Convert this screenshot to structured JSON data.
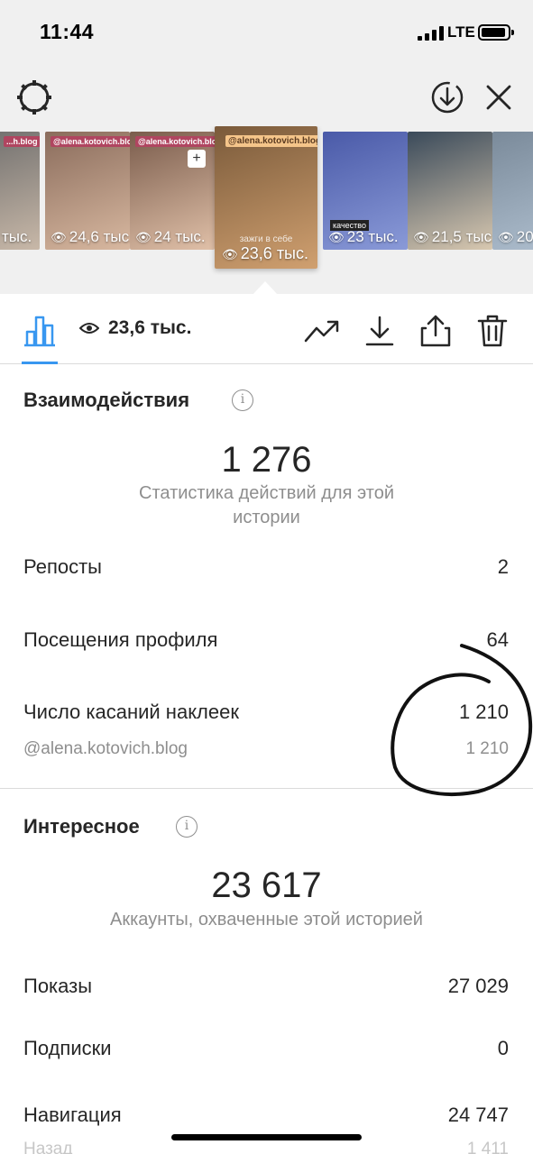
{
  "status_bar": {
    "time": "11:44",
    "network": "LTE"
  },
  "header": {
    "settings_icon": "gear-icon",
    "download_icon": "circle-download-icon",
    "close_icon": "close-icon"
  },
  "stories": [
    {
      "tag": "...h.blog",
      "views": "тыс.",
      "colors": [
        "#6a6a6a",
        "#c8b8a8"
      ]
    },
    {
      "tag": "@alena.kotovich.blog",
      "views": "24,6 тыс.",
      "colors": [
        "#8a6c5c",
        "#d8b8a0"
      ]
    },
    {
      "tag": "@alena.kotovich.blog",
      "views": "24 тыс.",
      "colors": [
        "#7a5c4c",
        "#e0c0a8"
      ]
    },
    {
      "tag": "@alena.kotovich.blog",
      "views": "23,6 тыс.",
      "caption": "зажги в себе",
      "colors": [
        "#7a5a3a",
        "#d0a070"
      ],
      "active": true
    },
    {
      "tag": "",
      "views": "23 тыс.",
      "caption": "качество",
      "colors": [
        "#4a5aa8",
        "#8a9ad8"
      ]
    },
    {
      "tag": "",
      "views": "21,5 тыс.",
      "colors": [
        "#3a4a5a",
        "#d8c8b0"
      ]
    },
    {
      "tag": "",
      "views": "20",
      "colors": [
        "#7a8a9a",
        "#b0c0d0"
      ]
    }
  ],
  "tabbar": {
    "views": "23,6 тыс.",
    "icons": [
      "bar-chart-icon",
      "trending-icon",
      "download-icon",
      "share-icon",
      "trash-icon"
    ]
  },
  "interactions": {
    "title": "Взаимодействия",
    "total": "1 276",
    "caption": "Статистика действий для этой истории",
    "rows": [
      {
        "label": "Репосты",
        "value": "2"
      },
      {
        "label": "Посещения профиля",
        "value": "64"
      },
      {
        "label": "Число касаний наклеек",
        "value": "1 210"
      }
    ],
    "sub_row": {
      "label": "@alena.kotovich.blog",
      "value": "1 210"
    }
  },
  "discovery": {
    "title": "Интересное",
    "total": "23 617",
    "caption": "Аккаунты, охваченные этой историей",
    "rows": [
      {
        "label": "Показы",
        "value": "27 029"
      },
      {
        "label": "Подписки",
        "value": "0"
      },
      {
        "label": "Навигация",
        "value": "24 747"
      }
    ],
    "faded_row": {
      "label": "Назад",
      "value": "1 411"
    }
  },
  "colors": {
    "accent": "#3897f0",
    "text": "#262626",
    "secondary": "#8e8e8e",
    "divider": "#dbdbdb"
  }
}
